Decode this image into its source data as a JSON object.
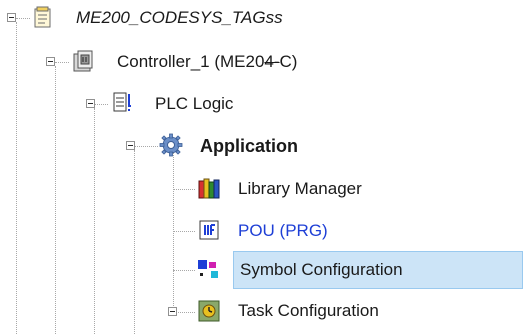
{
  "tree": {
    "project": {
      "label": "ME200_CODESYS_TAGss"
    },
    "controller": {
      "label_main": "Controller_1 (ME20",
      "label_strike": "4-",
      "label_tail": "C)"
    },
    "plc_logic": {
      "label": "PLC Logic"
    },
    "application": {
      "label": "Application"
    },
    "library_manager": {
      "label": "Library Manager"
    },
    "pou": {
      "label": "POU (PRG)"
    },
    "symbol_configuration": {
      "label": "Symbol Configuration"
    },
    "task_configuration": {
      "label": "Task Configuration"
    }
  },
  "colors": {
    "selection_bg": "#cce4f7",
    "selection_border": "#99c9ef",
    "link_text": "#1e3fd6"
  }
}
